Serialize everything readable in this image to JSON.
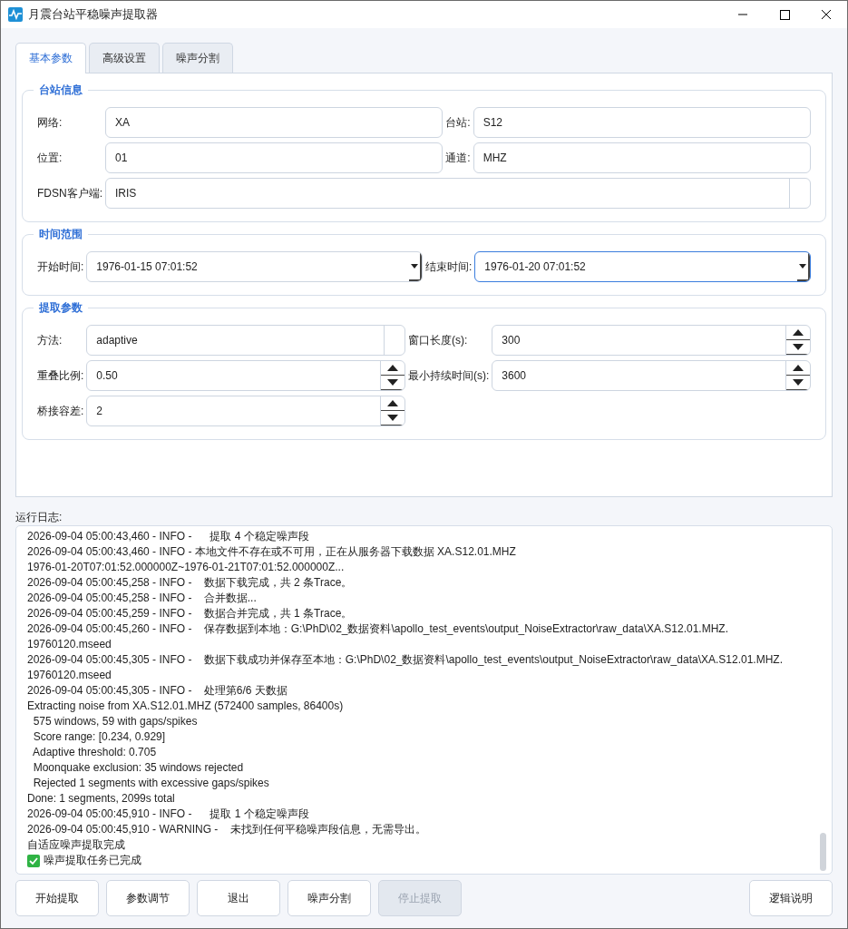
{
  "window": {
    "title": "月震台站平稳噪声提取器"
  },
  "tabs": [
    {
      "label": "基本参数",
      "selected": true
    },
    {
      "label": "高级设置",
      "selected": false
    },
    {
      "label": "噪声分割",
      "selected": false
    }
  ],
  "groups": [
    {
      "title": "台站信息",
      "fields": [
        {
          "label": "网络:",
          "kind": "text",
          "value": "XA"
        },
        {
          "label": "台站:",
          "kind": "text",
          "value": "S12"
        },
        {
          "label": "位置:",
          "kind": "text",
          "value": "01"
        },
        {
          "label": "通道:",
          "kind": "text",
          "value": "MHZ"
        },
        {
          "label": "FDSN客户端:",
          "kind": "select",
          "value": "IRIS",
          "wide": true
        }
      ]
    },
    {
      "title": "时间范围",
      "fields": [
        {
          "label": "开始时间:",
          "kind": "datetime",
          "value": "1976-01-15 07:01:52",
          "focused": false
        },
        {
          "label": "结束时间:",
          "kind": "datetime",
          "value": "1976-01-20 07:01:52",
          "focused": true
        }
      ]
    },
    {
      "title": "提取参数",
      "fields": [
        {
          "label": "方法:",
          "kind": "select",
          "value": "adaptive"
        },
        {
          "label": "窗口长度(s):",
          "kind": "spin",
          "value": "300"
        },
        {
          "label": "重叠比例:",
          "kind": "spin",
          "value": "0.50"
        },
        {
          "label": "最小持续时间(s):",
          "kind": "spin",
          "value": "3600"
        },
        {
          "label": "桥接容差:",
          "kind": "spin",
          "value": "2"
        }
      ]
    }
  ],
  "log": {
    "label": "运行日志:",
    "lines": [
      {
        "text": "2026-09-04 05:00:43,460 - INFO -      提取 4 个稳定噪声段"
      },
      {
        "text": "2026-09-04 05:00:43,460 - INFO - 本地文件不存在或不可用，正在从服务器下载数据 XA.S12.01.MHZ"
      },
      {
        "text": "1976-01-20T07:01:52.000000Z~1976-01-21T07:01:52.000000Z..."
      },
      {
        "text": "2026-09-04 05:00:45,258 - INFO -    数据下载完成，共 2 条Trace。"
      },
      {
        "text": "2026-09-04 05:00:45,258 - INFO -    合并数据..."
      },
      {
        "text": "2026-09-04 05:00:45,259 - INFO -    数据合并完成，共 1 条Trace。"
      },
      {
        "text": "2026-09-04 05:00:45,260 - INFO -    保存数据到本地：G:\\PhD\\02_数据资料\\apollo_test_events\\output_NoiseExtractor\\raw_data\\XA.S12.01.MHZ."
      },
      {
        "text": "19760120.mseed"
      },
      {
        "text": "2026-09-04 05:00:45,305 - INFO -    数据下载成功并保存至本地：G:\\PhD\\02_数据资料\\apollo_test_events\\output_NoiseExtractor\\raw_data\\XA.S12.01.MHZ."
      },
      {
        "text": "19760120.mseed"
      },
      {
        "text": "2026-09-04 05:00:45,305 - INFO -    处理第6/6 天数据"
      },
      {
        "text": "Extracting noise from XA.S12.01.MHZ (572400 samples, 86400s)"
      },
      {
        "text": "  575 windows, 59 with gaps/spikes"
      },
      {
        "text": "  Score range: [0.234, 0.929]"
      },
      {
        "text": "  Adaptive threshold: 0.705"
      },
      {
        "text": "  Moonquake exclusion: 35 windows rejected"
      },
      {
        "text": "  Rejected 1 segments with excessive gaps/spikes"
      },
      {
        "text": "Done: 1 segments, 2099s total"
      },
      {
        "text": "2026-09-04 05:00:45,910 - INFO -      提取 1 个稳定噪声段"
      },
      {
        "text": "2026-09-04 05:00:45,910 - WARNING -    未找到任何平稳噪声段信息，无需导出。"
      },
      {
        "text": "自适应噪声提取完成"
      },
      {
        "text": "噪声提取任务已完成",
        "kind": "done"
      }
    ]
  },
  "buttons": [
    {
      "label": "开始提取",
      "disabled": false
    },
    {
      "label": "参数调节",
      "disabled": false
    },
    {
      "label": "退出",
      "disabled": false
    },
    {
      "label": "噪声分割",
      "disabled": false
    },
    {
      "label": "停止提取",
      "disabled": true
    },
    {
      "label": "逻辑说明",
      "disabled": false,
      "kind": "right"
    }
  ]
}
